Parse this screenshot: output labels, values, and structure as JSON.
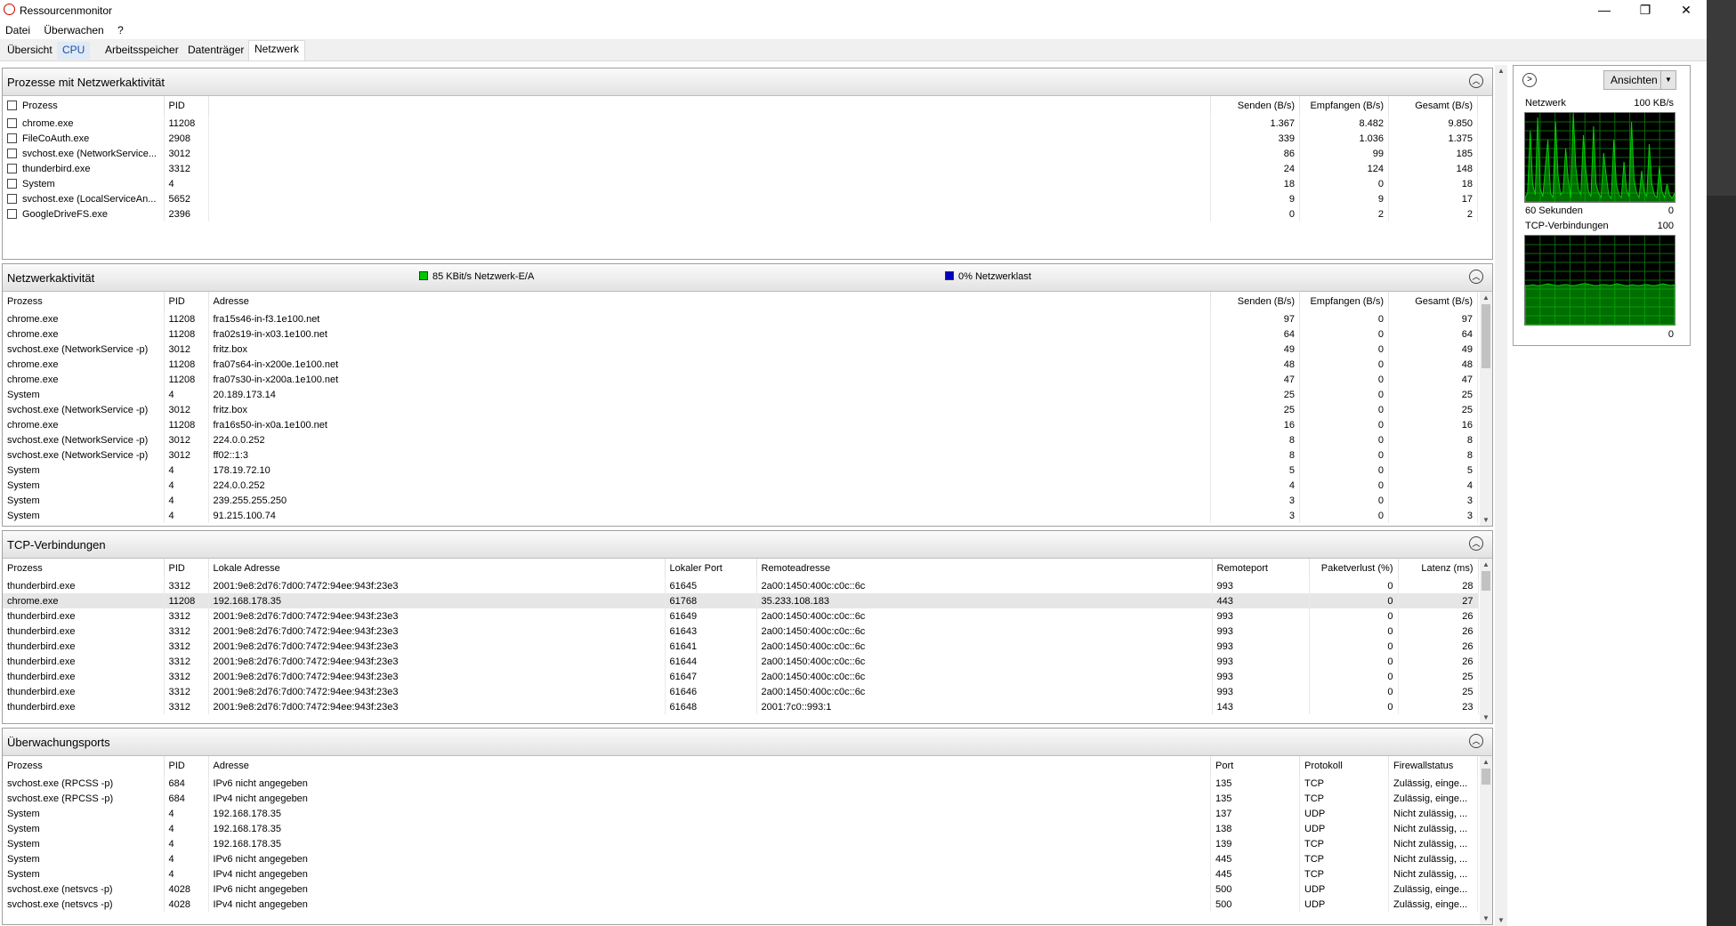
{
  "window": {
    "title": "Ressourcenmonitor",
    "min": "—",
    "max": "❐",
    "close": "✕"
  },
  "menu": [
    "Datei",
    "Überwachen",
    "?"
  ],
  "tabs": [
    "Übersicht",
    "CPU",
    "Arbeitsspeicher",
    "Datenträger",
    "Netzwerk"
  ],
  "colors": {
    "accent": "#1f4e9a",
    "graph_green": "#00d000",
    "graph_bg": "#000000",
    "io_legend": "#00c800",
    "load_legend": "#0000c0"
  },
  "procs": {
    "title": "Prozesse mit Netzwerkaktivität",
    "cols": [
      "Prozess",
      "PID",
      "Senden (B/s)",
      "Empfangen (B/s)",
      "Gesamt (B/s)"
    ],
    "rows": [
      [
        "chrome.exe",
        "11208",
        "1.367",
        "8.482",
        "9.850"
      ],
      [
        "FileCoAuth.exe",
        "2908",
        "339",
        "1.036",
        "1.375"
      ],
      [
        "svchost.exe (NetworkService...",
        "3012",
        "86",
        "99",
        "185"
      ],
      [
        "thunderbird.exe",
        "3312",
        "24",
        "124",
        "148"
      ],
      [
        "System",
        "4",
        "18",
        "0",
        "18"
      ],
      [
        "svchost.exe (LocalServiceAn...",
        "5652",
        "9",
        "9",
        "17"
      ],
      [
        "GoogleDriveFS.exe",
        "2396",
        "0",
        "2",
        "2"
      ]
    ]
  },
  "activity": {
    "title": "Netzwerkaktivität",
    "legend_io": "85 KBit/s Netzwerk-E/A",
    "legend_load": "0% Netzwerklast",
    "cols": [
      "Prozess",
      "PID",
      "Adresse",
      "Senden (B/s)",
      "Empfangen (B/s)",
      "Gesamt (B/s)"
    ],
    "rows": [
      [
        "chrome.exe",
        "11208",
        "fra15s46-in-f3.1e100.net",
        "97",
        "0",
        "97"
      ],
      [
        "chrome.exe",
        "11208",
        "fra02s19-in-x03.1e100.net",
        "64",
        "0",
        "64"
      ],
      [
        "svchost.exe (NetworkService -p)",
        "3012",
        "fritz.box",
        "49",
        "0",
        "49"
      ],
      [
        "chrome.exe",
        "11208",
        "fra07s64-in-x200e.1e100.net",
        "48",
        "0",
        "48"
      ],
      [
        "chrome.exe",
        "11208",
        "fra07s30-in-x200a.1e100.net",
        "47",
        "0",
        "47"
      ],
      [
        "System",
        "4",
        "20.189.173.14",
        "25",
        "0",
        "25"
      ],
      [
        "svchost.exe (NetworkService -p)",
        "3012",
        "fritz.box",
        "25",
        "0",
        "25"
      ],
      [
        "chrome.exe",
        "11208",
        "fra16s50-in-x0a.1e100.net",
        "16",
        "0",
        "16"
      ],
      [
        "svchost.exe (NetworkService -p)",
        "3012",
        "224.0.0.252",
        "8",
        "0",
        "8"
      ],
      [
        "svchost.exe (NetworkService -p)",
        "3012",
        "ff02::1:3",
        "8",
        "0",
        "8"
      ],
      [
        "System",
        "4",
        "178.19.72.10",
        "5",
        "0",
        "5"
      ],
      [
        "System",
        "4",
        "224.0.0.252",
        "4",
        "0",
        "4"
      ],
      [
        "System",
        "4",
        "239.255.255.250",
        "3",
        "0",
        "3"
      ],
      [
        "System",
        "4",
        "91.215.100.74",
        "3",
        "0",
        "3"
      ]
    ]
  },
  "tcp": {
    "title": "TCP-Verbindungen",
    "cols": [
      "Prozess",
      "PID",
      "Lokale Adresse",
      "Lokaler Port",
      "Remoteadresse",
      "Remoteport",
      "Paketverlust (%)",
      "Latenz (ms)"
    ],
    "rows": [
      [
        "thunderbird.exe",
        "3312",
        "2001:9e8:2d76:7d00:7472:94ee:943f:23e3",
        "61645",
        "2a00:1450:400c:c0c::6c",
        "993",
        "0",
        "28"
      ],
      [
        "chrome.exe",
        "11208",
        "192.168.178.35",
        "61768",
        "35.233.108.183",
        "443",
        "0",
        "27"
      ],
      [
        "thunderbird.exe",
        "3312",
        "2001:9e8:2d76:7d00:7472:94ee:943f:23e3",
        "61649",
        "2a00:1450:400c:c0c::6c",
        "993",
        "0",
        "26"
      ],
      [
        "thunderbird.exe",
        "3312",
        "2001:9e8:2d76:7d00:7472:94ee:943f:23e3",
        "61643",
        "2a00:1450:400c:c0c::6c",
        "993",
        "0",
        "26"
      ],
      [
        "thunderbird.exe",
        "3312",
        "2001:9e8:2d76:7d00:7472:94ee:943f:23e3",
        "61641",
        "2a00:1450:400c:c0c::6c",
        "993",
        "0",
        "26"
      ],
      [
        "thunderbird.exe",
        "3312",
        "2001:9e8:2d76:7d00:7472:94ee:943f:23e3",
        "61644",
        "2a00:1450:400c:c0c::6c",
        "993",
        "0",
        "26"
      ],
      [
        "thunderbird.exe",
        "3312",
        "2001:9e8:2d76:7d00:7472:94ee:943f:23e3",
        "61647",
        "2a00:1450:400c:c0c::6c",
        "993",
        "0",
        "25"
      ],
      [
        "thunderbird.exe",
        "3312",
        "2001:9e8:2d76:7d00:7472:94ee:943f:23e3",
        "61646",
        "2a00:1450:400c:c0c::6c",
        "993",
        "0",
        "25"
      ],
      [
        "thunderbird.exe",
        "3312",
        "2001:9e8:2d76:7d00:7472:94ee:943f:23e3",
        "61648",
        "2001:7c0::993:1",
        "143",
        "0",
        "23"
      ]
    ]
  },
  "ports": {
    "title": "Überwachungsports",
    "cols": [
      "Prozess",
      "PID",
      "Adresse",
      "Port",
      "Protokoll",
      "Firewallstatus"
    ],
    "rows": [
      [
        "svchost.exe (RPCSS -p)",
        "684",
        "IPv6 nicht angegeben",
        "135",
        "TCP",
        "Zulässig, einge..."
      ],
      [
        "svchost.exe (RPCSS -p)",
        "684",
        "IPv4 nicht angegeben",
        "135",
        "TCP",
        "Zulässig, einge..."
      ],
      [
        "System",
        "4",
        "192.168.178.35",
        "137",
        "UDP",
        "Nicht zulässig, ..."
      ],
      [
        "System",
        "4",
        "192.168.178.35",
        "138",
        "UDP",
        "Nicht zulässig, ..."
      ],
      [
        "System",
        "4",
        "192.168.178.35",
        "139",
        "TCP",
        "Nicht zulässig, ..."
      ],
      [
        "System",
        "4",
        "IPv6 nicht angegeben",
        "445",
        "TCP",
        "Nicht zulässig, ..."
      ],
      [
        "System",
        "4",
        "IPv4 nicht angegeben",
        "445",
        "TCP",
        "Nicht zulässig, ..."
      ],
      [
        "svchost.exe (netsvcs -p)",
        "4028",
        "IPv6 nicht angegeben",
        "500",
        "UDP",
        "Zulässig, einge..."
      ],
      [
        "svchost.exe (netsvcs -p)",
        "4028",
        "IPv4 nicht angegeben",
        "500",
        "UDP",
        "Zulässig, einge..."
      ]
    ]
  },
  "side": {
    "view_label": "Ansichten",
    "net_label": "Netzwerk",
    "net_max": "100 KB/s",
    "seconds": "60 Sekunden",
    "net_min": "0",
    "tcp_label": "TCP-Verbindungen",
    "tcp_max": "100",
    "tcp_min": "0",
    "net_series": [
      5,
      10,
      80,
      20,
      8,
      95,
      15,
      6,
      40,
      70,
      10,
      5,
      90,
      30,
      8,
      12,
      60,
      25,
      5,
      100,
      40,
      15,
      8,
      75,
      35,
      12,
      6,
      85,
      20,
      10,
      5,
      55,
      30,
      8,
      4,
      70,
      20,
      8,
      5,
      45,
      15,
      6,
      90,
      25,
      10,
      5,
      35,
      12,
      6,
      65,
      20,
      8,
      5,
      40,
      12,
      5,
      20,
      8,
      4,
      10
    ],
    "tcp_series": [
      44,
      44,
      45,
      44,
      44,
      45,
      46,
      45,
      44,
      44,
      45,
      45,
      44,
      44,
      45,
      46,
      46,
      45,
      44,
      44,
      45,
      45,
      44,
      45,
      46,
      45,
      44,
      44,
      45,
      44,
      44,
      45,
      45,
      44,
      44,
      45,
      46,
      45,
      44,
      45
    ]
  }
}
